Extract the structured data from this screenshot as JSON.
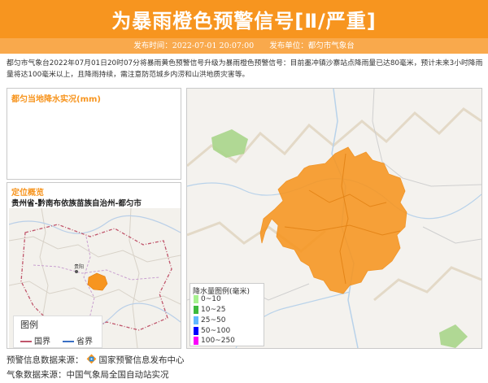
{
  "header": {
    "title": "为暴雨橙色预警信号[Ⅱ/严重]",
    "publish_time_label": "发布时间：2022-07-01 20:07:00",
    "publish_unit_label": "发布单位：都匀市气象台"
  },
  "description": "都匀市气象台2022年07月01日20时07分将暴雨黄色预警信号升级为暴雨橙色预警信号：目前墨冲镇沙寨站点降雨量已达80毫米，预计未来3小时降雨量将达100毫米以上，且降雨持续，需注意防范城乡内涝和山洪地质灾害等。",
  "rain_panel": {
    "title": "都匀当地降水实况(mm)"
  },
  "location_panel": {
    "title": "定位概览",
    "path": "贵州省-黔南布依族苗族自治州-都匀市",
    "map_city_label": "贵阳",
    "legend": {
      "title": "图例",
      "items": [
        {
          "label": "国界",
          "color": "#c0556b"
        },
        {
          "label": "省界",
          "color": "#3a6fc4"
        }
      ]
    }
  },
  "rain_legend": {
    "title": "降水量图例(毫米)",
    "items": [
      {
        "label": "0~10",
        "color": "#a6f28f"
      },
      {
        "label": "10~25",
        "color": "#3dba3d"
      },
      {
        "label": "25~50",
        "color": "#61b8ff"
      },
      {
        "label": "50~100",
        "color": "#0000ff"
      },
      {
        "label": "100~250",
        "color": "#fa00fa"
      }
    ]
  },
  "footer": {
    "warning_source_prefix": "预警信息数据来源：",
    "warning_source_name": "国家预警信息发布中心",
    "weather_source": "气象数据来源：中国气象局全国自动站实况"
  },
  "colors": {
    "accent": "#f7951f",
    "warning_area": "#f7951f"
  }
}
